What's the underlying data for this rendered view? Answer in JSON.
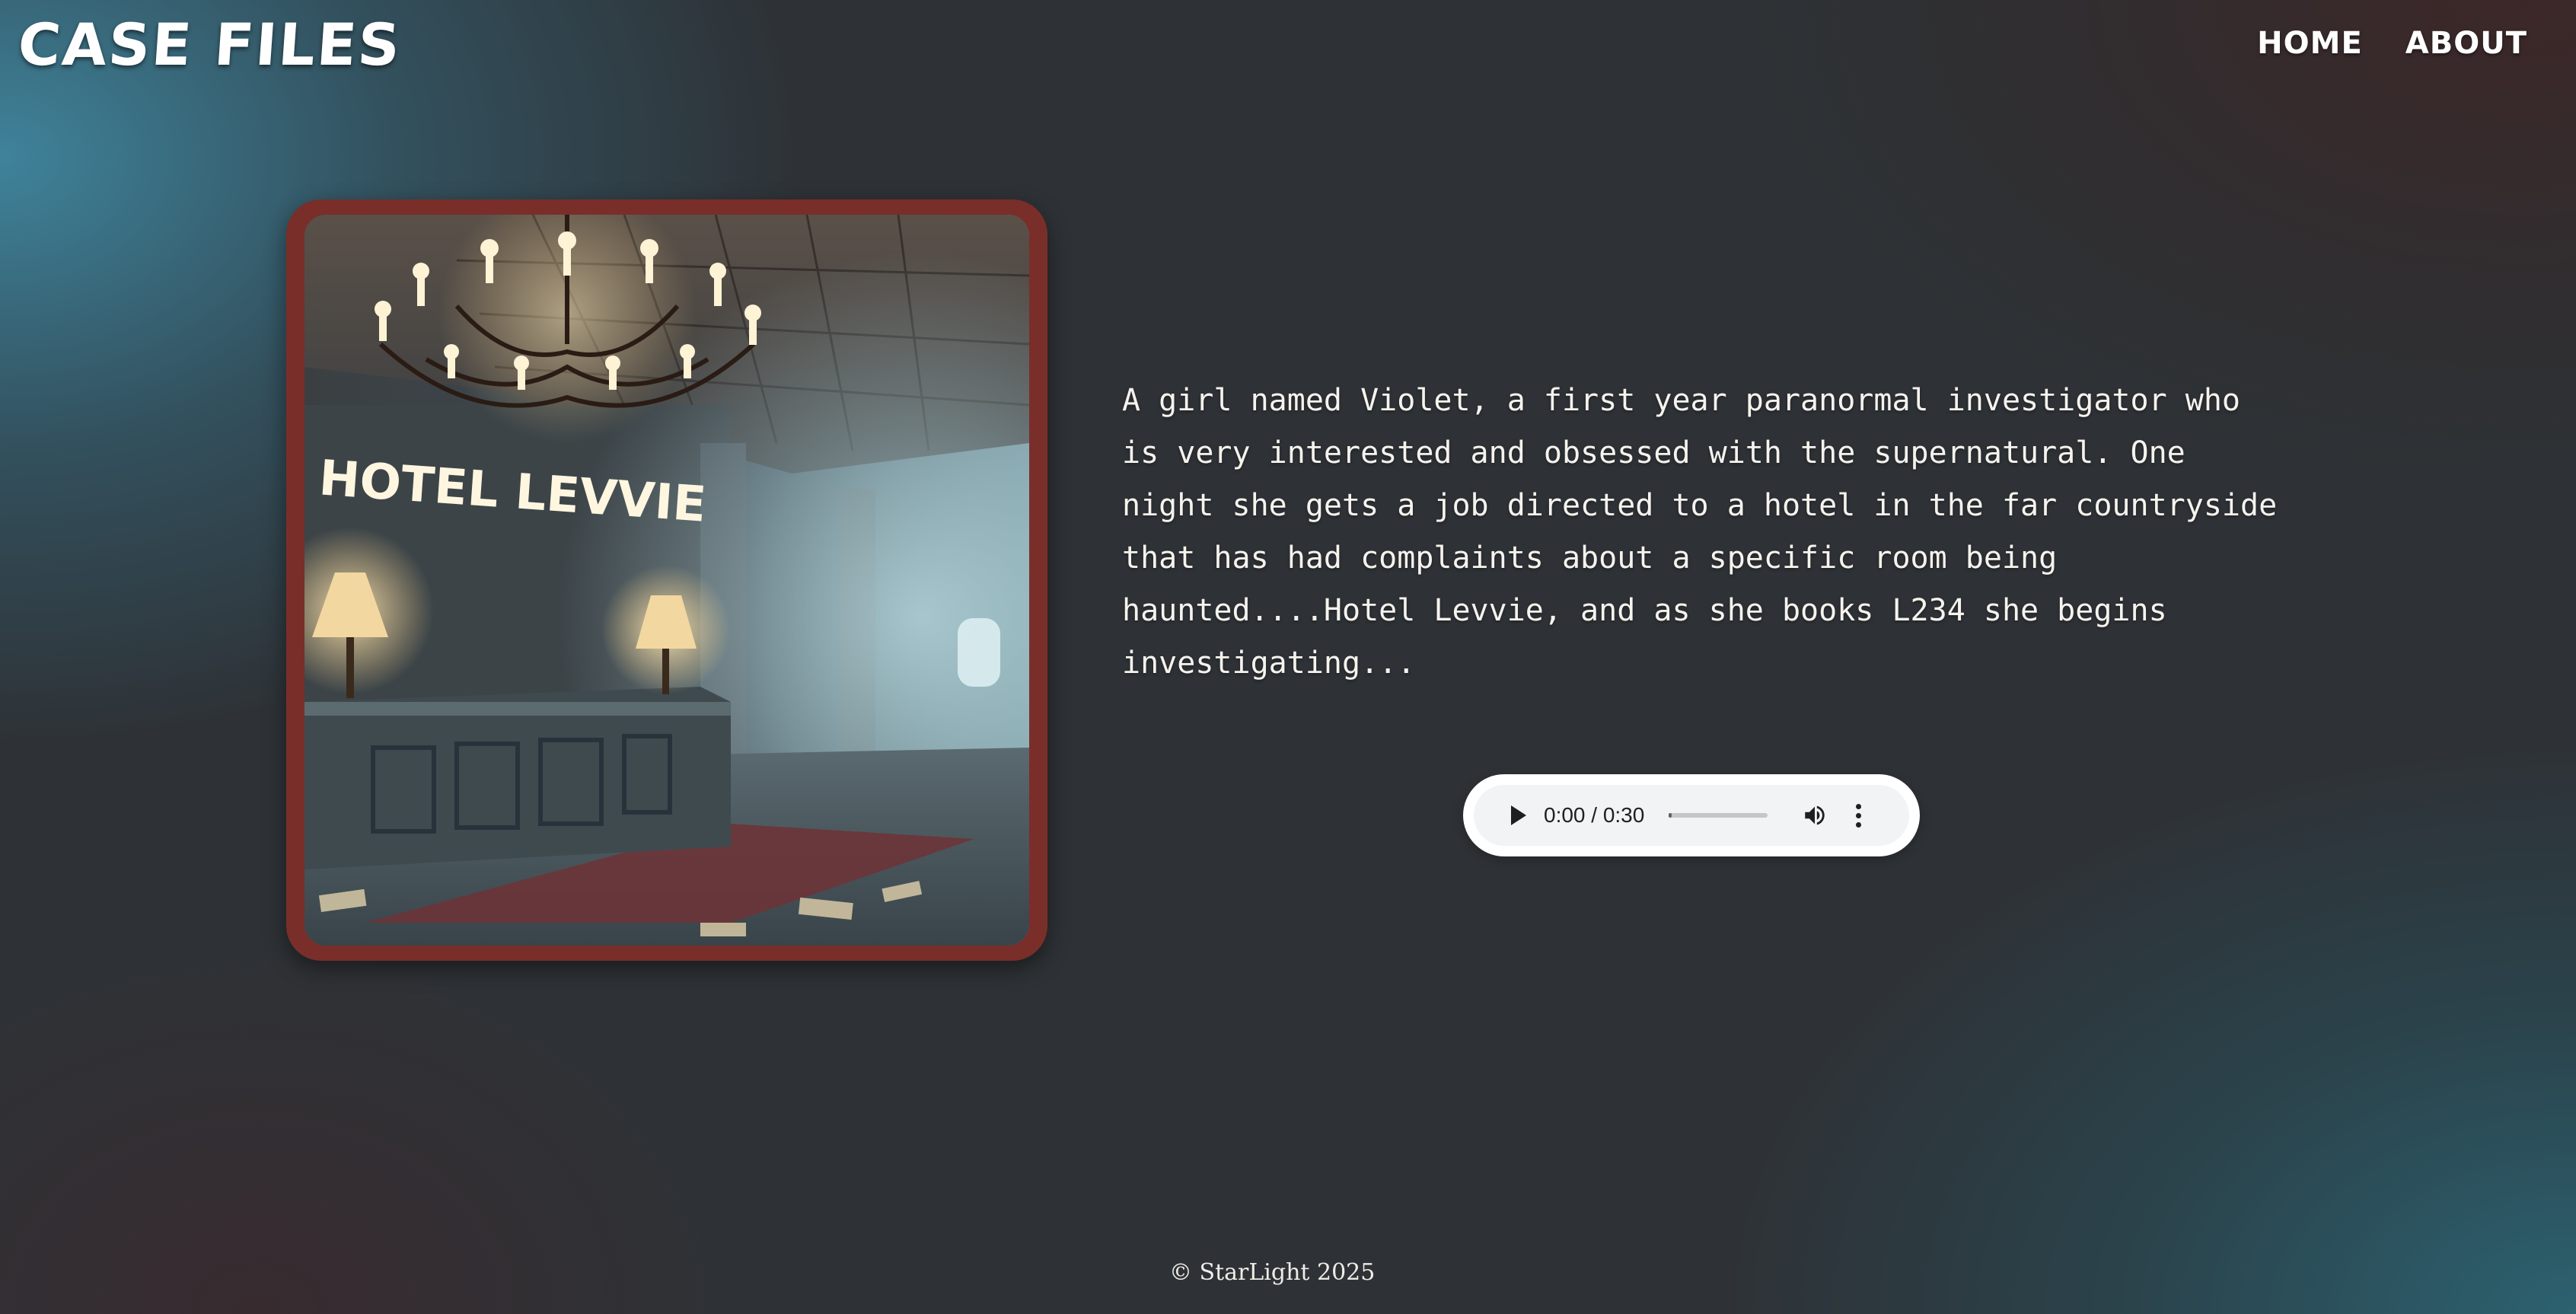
{
  "header": {
    "logo": "CASE FILES",
    "nav": [
      {
        "label": "HOME"
      },
      {
        "label": "ABOUT"
      }
    ]
  },
  "hero_image": {
    "sign_text": "HOTEL LEVVIE",
    "frame_color": "#7a2e29"
  },
  "story": {
    "text": "A girl named Violet, a first year paranormal investigator who is very interested and obsessed with the supernatural. One night she gets a job directed to a hotel in the far countryside that has had complaints about a specific room being haunted....Hotel Levvie, and as she books L234 she begins investigating..."
  },
  "audio": {
    "time_display": "0:00 / 0:30",
    "progress_fraction": 0.03,
    "controls": [
      "play-icon",
      "volume-icon",
      "more-options-icon"
    ]
  },
  "footer": {
    "text": "© StarLight 2025"
  }
}
